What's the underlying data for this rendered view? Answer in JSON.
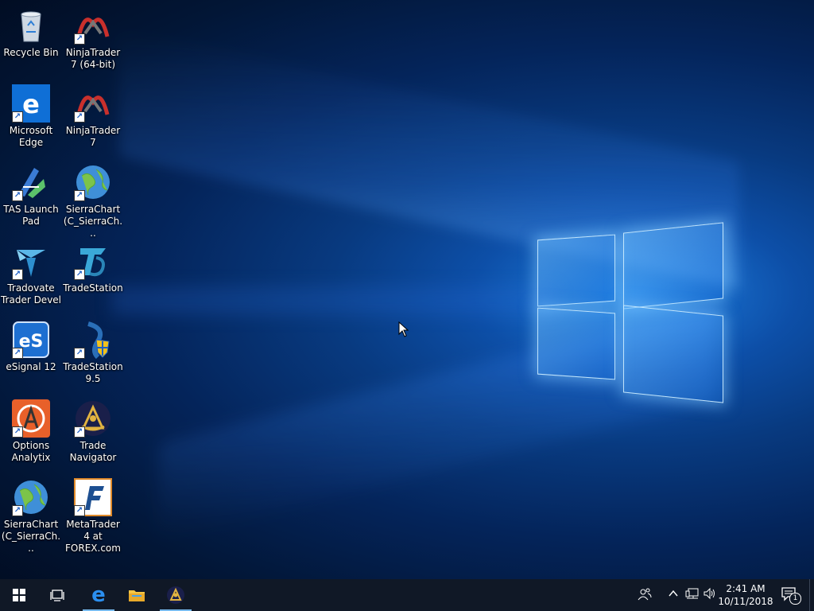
{
  "desktop": {
    "icons": [
      {
        "label": "Recycle Bin",
        "icon": "recycle-bin-icon"
      },
      {
        "label": "NinjaTrader 7 (64-bit)",
        "icon": "ninjatrader-icon"
      },
      {
        "label": "Microsoft Edge",
        "icon": "edge-icon"
      },
      {
        "label": "NinjaTrader 7",
        "icon": "ninjatrader-icon"
      },
      {
        "label": "TAS Launch Pad",
        "icon": "tas-launchpad-icon"
      },
      {
        "label": "SierraChart (C_SierraCh...",
        "icon": "globe-icon"
      },
      {
        "label": "Tradovate Trader Devel",
        "icon": "tradovate-icon"
      },
      {
        "label": "TradeStation",
        "icon": "tradestation-icon"
      },
      {
        "label": "eSignal 12",
        "icon": "esignal-icon"
      },
      {
        "label": "TradeStation 9.5",
        "icon": "tradestation-shield-icon"
      },
      {
        "label": "Options Analytix",
        "icon": "options-analytix-icon"
      },
      {
        "label": "Trade Navigator",
        "icon": "sextant-icon"
      },
      {
        "label": "SierraChart (C_SierraCh...",
        "icon": "globe-icon"
      },
      {
        "label": "MetaTrader 4 at FOREX.com",
        "icon": "metatrader-icon"
      }
    ]
  },
  "taskbar": {
    "start": "windows-start-icon",
    "task_view": "task-view-icon",
    "pinned": [
      "edge-icon",
      "file-explorer-icon",
      "trade-navigator-icon"
    ],
    "tray": {
      "people": "people-icon",
      "show_hidden": "chevron-up-icon",
      "network": "network-icon",
      "volume": "volume-icon",
      "time": "2:41 AM",
      "date": "10/11/2018",
      "notifications_count": "1"
    }
  },
  "colors": {
    "taskbar": "#101826",
    "accent": "#76b9ed",
    "wallpaper": "#0d4fa8"
  }
}
